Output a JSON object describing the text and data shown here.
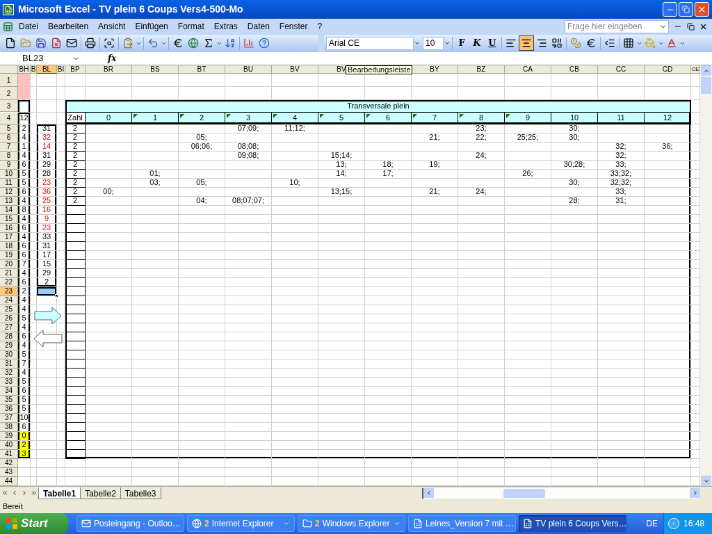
{
  "window": {
    "title": "Microsoft Excel - TV plein 6 Coups Vers4-500-Mo"
  },
  "menu": [
    {
      "label": "Datei"
    },
    {
      "label": "Bearbeiten"
    },
    {
      "label": "Ansicht"
    },
    {
      "label": "Einfügen"
    },
    {
      "label": "Format"
    },
    {
      "label": "Extras"
    },
    {
      "label": "Daten"
    },
    {
      "label": "Fenster"
    },
    {
      "label": "?"
    }
  ],
  "help_search": {
    "placeholder": "Frage hier eingeben"
  },
  "toolbar": {
    "font": "Arial CE",
    "size": "10",
    "styles": [
      {
        "label": "F",
        "kind": "bold"
      },
      {
        "label": "K",
        "kind": "italic"
      },
      {
        "label": "U",
        "kind": "underline"
      }
    ],
    "align": [
      {
        "kind": "left",
        "selected": false
      },
      {
        "kind": "center",
        "selected": true
      },
      {
        "kind": "right",
        "selected": false
      }
    ]
  },
  "formula_bar": {
    "name_box": "BL23",
    "fx": "fx"
  },
  "tooltip": "Bearbeitungsleiste",
  "sheet": {
    "columns": [
      {
        "label": "BH",
        "selected": false
      },
      {
        "label": "B",
        "selected": false
      },
      {
        "label": "BL",
        "selected": true
      },
      {
        "label": "BI",
        "selected": false
      },
      {
        "label": "BP",
        "selected": false
      },
      {
        "label": "BR",
        "selected": false
      },
      {
        "label": "BS",
        "selected": false
      },
      {
        "label": "BT",
        "selected": false
      },
      {
        "label": "BU",
        "selected": false
      },
      {
        "label": "BV",
        "selected": false
      },
      {
        "label": "BV",
        "selected": false
      },
      {
        "label": "BY",
        "selected": false
      },
      {
        "label": "BZ",
        "selected": false
      },
      {
        "label": "CA",
        "selected": false
      },
      {
        "label": "CB",
        "selected": false
      },
      {
        "label": "CC",
        "selected": false
      },
      {
        "label": "CD",
        "selected": false
      },
      {
        "label": "CE",
        "selected": false
      }
    ],
    "rows": [
      {
        "label": "1",
        "selected": false,
        "color": "#ffc0c0"
      },
      {
        "label": "2",
        "selected": false,
        "color": "#ffc0c0"
      },
      {
        "label": "3",
        "selected": false
      },
      {
        "label": "4",
        "selected": false,
        "bh": "12"
      },
      {
        "label": "5",
        "selected": false,
        "bh": "2",
        "bl": "31",
        "bl_red": false,
        "zahl": "2",
        "cells": [
          null,
          null,
          null,
          "07;09;",
          "11;12;",
          null,
          null,
          null,
          "23;",
          null,
          "30;",
          null,
          null
        ]
      },
      {
        "label": "6",
        "selected": false,
        "bh": "4",
        "bl": "32",
        "bl_red": true,
        "zahl": "2",
        "cells": [
          null,
          null,
          "05;",
          null,
          null,
          null,
          null,
          "21;",
          "22;",
          "25;25;",
          "30;",
          null,
          null
        ]
      },
      {
        "label": "7",
        "selected": false,
        "bh": "1",
        "bl": "14",
        "bl_red": true,
        "zahl": "2",
        "cells": [
          null,
          null,
          "06;06;",
          "08;08;",
          null,
          null,
          null,
          null,
          null,
          null,
          null,
          "32;",
          "36;"
        ]
      },
      {
        "label": "8",
        "selected": false,
        "bh": "4",
        "bl": "31",
        "bl_red": false,
        "zahl": "2",
        "cells": [
          null,
          null,
          null,
          "09;08;",
          null,
          "15;14;",
          null,
          null,
          "24;",
          null,
          null,
          "32;",
          null
        ]
      },
      {
        "label": "9",
        "selected": false,
        "bh": "6",
        "bl": "29",
        "bl_red": false,
        "zahl": "2",
        "cells": [
          null,
          null,
          null,
          null,
          null,
          "13;",
          "18;",
          "19;",
          null,
          null,
          "30;28;",
          "33;",
          null
        ]
      },
      {
        "label": "10",
        "selected": false,
        "bh": "5",
        "bl": "28",
        "bl_red": false,
        "zahl": "2",
        "cells": [
          null,
          "01;",
          null,
          null,
          null,
          "14;",
          "17;",
          null,
          null,
          "26;",
          null,
          "33;32;",
          null
        ]
      },
      {
        "label": "11",
        "selected": false,
        "bh": "5",
        "bl": "23",
        "bl_red": true,
        "zahl": "2",
        "cells": [
          null,
          "03;",
          "05;",
          null,
          "10;",
          null,
          null,
          null,
          null,
          null,
          "30;",
          "32;32;",
          null
        ]
      },
      {
        "label": "12",
        "selected": false,
        "bh": "6",
        "bl": "36",
        "bl_red": true,
        "zahl": "2",
        "cells": [
          "00;",
          null,
          null,
          null,
          null,
          "13;15;",
          null,
          "21;",
          "24;",
          null,
          null,
          "33;",
          null
        ]
      },
      {
        "label": "13",
        "selected": false,
        "bh": "4",
        "bl": "25",
        "bl_red": true,
        "zahl": "2",
        "cells": [
          null,
          null,
          "04;",
          "08;07;07;",
          null,
          null,
          null,
          null,
          null,
          null,
          "28;",
          "31;",
          null
        ]
      },
      {
        "label": "14",
        "selected": false,
        "bh": "8",
        "bl": "16",
        "bl_red": true
      },
      {
        "label": "15",
        "selected": false,
        "bh": "4",
        "bl": "9",
        "bl_red": true
      },
      {
        "label": "16",
        "selected": false,
        "bh": "6",
        "bl": "23",
        "bl_red": true
      },
      {
        "label": "17",
        "selected": false,
        "bh": "4",
        "bl": "33",
        "bl_red": false
      },
      {
        "label": "18",
        "selected": false,
        "bh": "6",
        "bl": "31",
        "bl_red": false
      },
      {
        "label": "19",
        "selected": false,
        "bh": "6",
        "bl": "17",
        "bl_red": false
      },
      {
        "label": "20",
        "selected": false,
        "bh": "7",
        "bl": "15",
        "bl_red": false
      },
      {
        "label": "21",
        "selected": false,
        "bh": "4",
        "bl": "29",
        "bl_red": false
      },
      {
        "label": "22",
        "selected": false,
        "bh": "6",
        "bl": "2",
        "bl_red": false
      },
      {
        "label": "23",
        "selected": true,
        "bh": "2"
      },
      {
        "label": "24",
        "selected": false,
        "bh": "4"
      },
      {
        "label": "25",
        "selected": false,
        "bh": "4"
      },
      {
        "label": "26",
        "selected": false,
        "bh": "5"
      },
      {
        "label": "27",
        "selected": false,
        "bh": "4"
      },
      {
        "label": "28",
        "selected": false,
        "bh": "6"
      },
      {
        "label": "29",
        "selected": false,
        "bh": "4"
      },
      {
        "label": "30",
        "selected": false,
        "bh": "5"
      },
      {
        "label": "31",
        "selected": false,
        "bh": "7"
      },
      {
        "label": "32",
        "selected": false,
        "bh": "4"
      },
      {
        "label": "33",
        "selected": false,
        "bh": "5"
      },
      {
        "label": "34",
        "selected": false,
        "bh": "6"
      },
      {
        "label": "35",
        "selected": false,
        "bh": "5"
      },
      {
        "label": "36",
        "selected": false,
        "bh": "5"
      },
      {
        "label": "37",
        "selected": false,
        "bh": "10"
      },
      {
        "label": "38",
        "selected": false,
        "bh": "6"
      },
      {
        "label": "39",
        "selected": false,
        "bh": "0",
        "color": "#ffff00"
      },
      {
        "label": "40",
        "selected": false,
        "bh": "2",
        "color": "#ffff00"
      },
      {
        "label": "41",
        "selected": false,
        "bh": "3",
        "color": "#ffff00"
      },
      {
        "label": "42",
        "selected": false
      },
      {
        "label": "43",
        "selected": false
      },
      {
        "label": "44",
        "selected": false
      }
    ]
  },
  "table": {
    "title": "Transversale plein",
    "header": "Zahl",
    "columns": [
      {
        "label": "0",
        "note": false
      },
      {
        "label": "1",
        "note": true
      },
      {
        "label": "2",
        "note": true
      },
      {
        "label": "3",
        "note": true
      },
      {
        "label": "4",
        "note": true
      },
      {
        "label": "5",
        "note": true
      },
      {
        "label": "6",
        "note": true
      },
      {
        "label": "7",
        "note": true
      },
      {
        "label": "8",
        "note": true
      },
      {
        "label": "9",
        "note": true
      },
      {
        "label": "10",
        "note": false
      },
      {
        "label": "11",
        "note": false
      },
      {
        "label": "12",
        "note": false
      }
    ]
  },
  "sheet_tabs": [
    {
      "label": "Tabelle1",
      "selected": true
    },
    {
      "label": "Tabelle2",
      "selected": false
    },
    {
      "label": "Tabelle3",
      "selected": false
    }
  ],
  "status_bar": {
    "text": "Bereit"
  },
  "taskbar": {
    "start": "Start",
    "tasks": [
      {
        "label": "Posteingang - Outloo…",
        "kind": "mail",
        "selected": false
      },
      {
        "count": "2",
        "label": "Internet Explorer",
        "kind": "browser",
        "selected": false
      },
      {
        "count": "2",
        "label": "Windows Explorer",
        "kind": "folder",
        "selected": false
      },
      {
        "label": "Leines_Version 7 mit …",
        "kind": "excel",
        "selected": false
      },
      {
        "label": "TV plein 6 Coups Vers…",
        "kind": "excel",
        "selected": true
      }
    ],
    "language": "DE",
    "clock": "16:48"
  }
}
